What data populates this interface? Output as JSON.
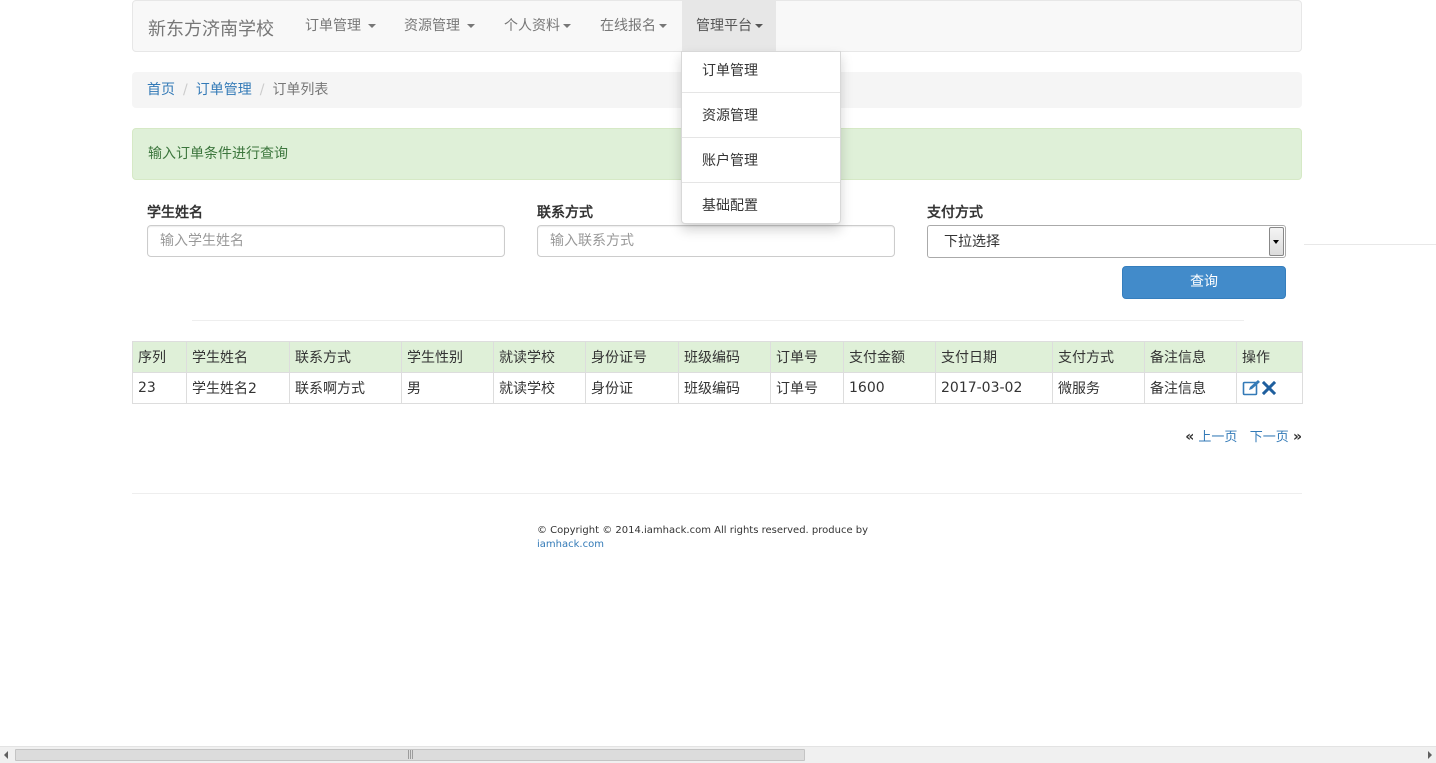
{
  "navbar": {
    "brand": "新东方济南学校",
    "items": [
      {
        "label": "订单管理 "
      },
      {
        "label": "资源管理 "
      },
      {
        "label": "个人资料"
      },
      {
        "label": "在线报名"
      },
      {
        "label": "管理平台"
      }
    ],
    "dropdown": [
      "订单管理",
      "资源管理",
      "账户管理",
      "基础配置"
    ]
  },
  "breadcrumb": {
    "home": "首页",
    "section": "订单管理",
    "current": "订单列表",
    "separator": "/"
  },
  "alert": {
    "text": "输入订单条件进行查询"
  },
  "form": {
    "student_name_label": "学生姓名",
    "student_name_placeholder": "输入学生姓名",
    "contact_label": "联系方式",
    "contact_placeholder": "输入联系方式",
    "payment_label": "支付方式",
    "payment_selected": "下拉选择",
    "query_button": "查询"
  },
  "table": {
    "headers": [
      "序列",
      "学生姓名",
      "联系方式",
      "学生性别",
      "就读学校",
      "身份证号",
      "班级编码",
      "订单号",
      "支付金额",
      "支付日期",
      "支付方式",
      "备注信息",
      "操作"
    ],
    "rows": [
      [
        "23",
        "学生姓名2",
        "联系啊方式",
        "男",
        "就读学校",
        "身份证",
        "班级编码",
        "订单号",
        "1600",
        "2017-03-02",
        "微服务",
        "备注信息"
      ]
    ],
    "actions": [
      "edit-icon",
      "delete-icon"
    ]
  },
  "pager": {
    "prev": "上一页",
    "next": "下一页",
    "prev_glyph": "«",
    "next_glyph": "»"
  },
  "footer": {
    "copyright": "© Copyright © 2014.iamhack.com All rights reserved. produce by",
    "link": "iamhack.com"
  },
  "colors": {
    "accent": "#428bca",
    "link": "#337ab7",
    "success_bg": "#dff0d8",
    "success_text": "#3c763d",
    "delete": "#1f5f9e"
  }
}
